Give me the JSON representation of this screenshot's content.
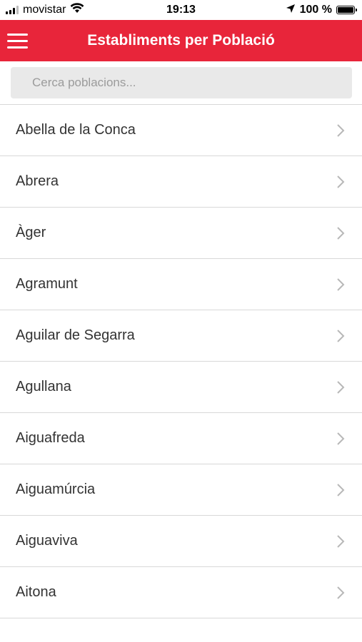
{
  "status_bar": {
    "carrier": "movistar",
    "time": "19:13",
    "battery": "100 %",
    "icons": [
      "signal-icon",
      "wifi-icon",
      "location-arrow-icon",
      "battery-icon"
    ]
  },
  "header": {
    "title": "Establiments per Població",
    "menu_icon": "hamburger-menu-icon",
    "background_color": "#e8253a"
  },
  "search": {
    "placeholder": "Cerca poblacions...",
    "value": ""
  },
  "towns": [
    {
      "label": "Abella de la Conca"
    },
    {
      "label": "Abrera"
    },
    {
      "label": "Àger"
    },
    {
      "label": "Agramunt"
    },
    {
      "label": "Aguilar de Segarra"
    },
    {
      "label": "Agullana"
    },
    {
      "label": "Aiguafreda"
    },
    {
      "label": "Aiguamúrcia"
    },
    {
      "label": "Aiguaviva"
    },
    {
      "label": "Aitona"
    }
  ]
}
